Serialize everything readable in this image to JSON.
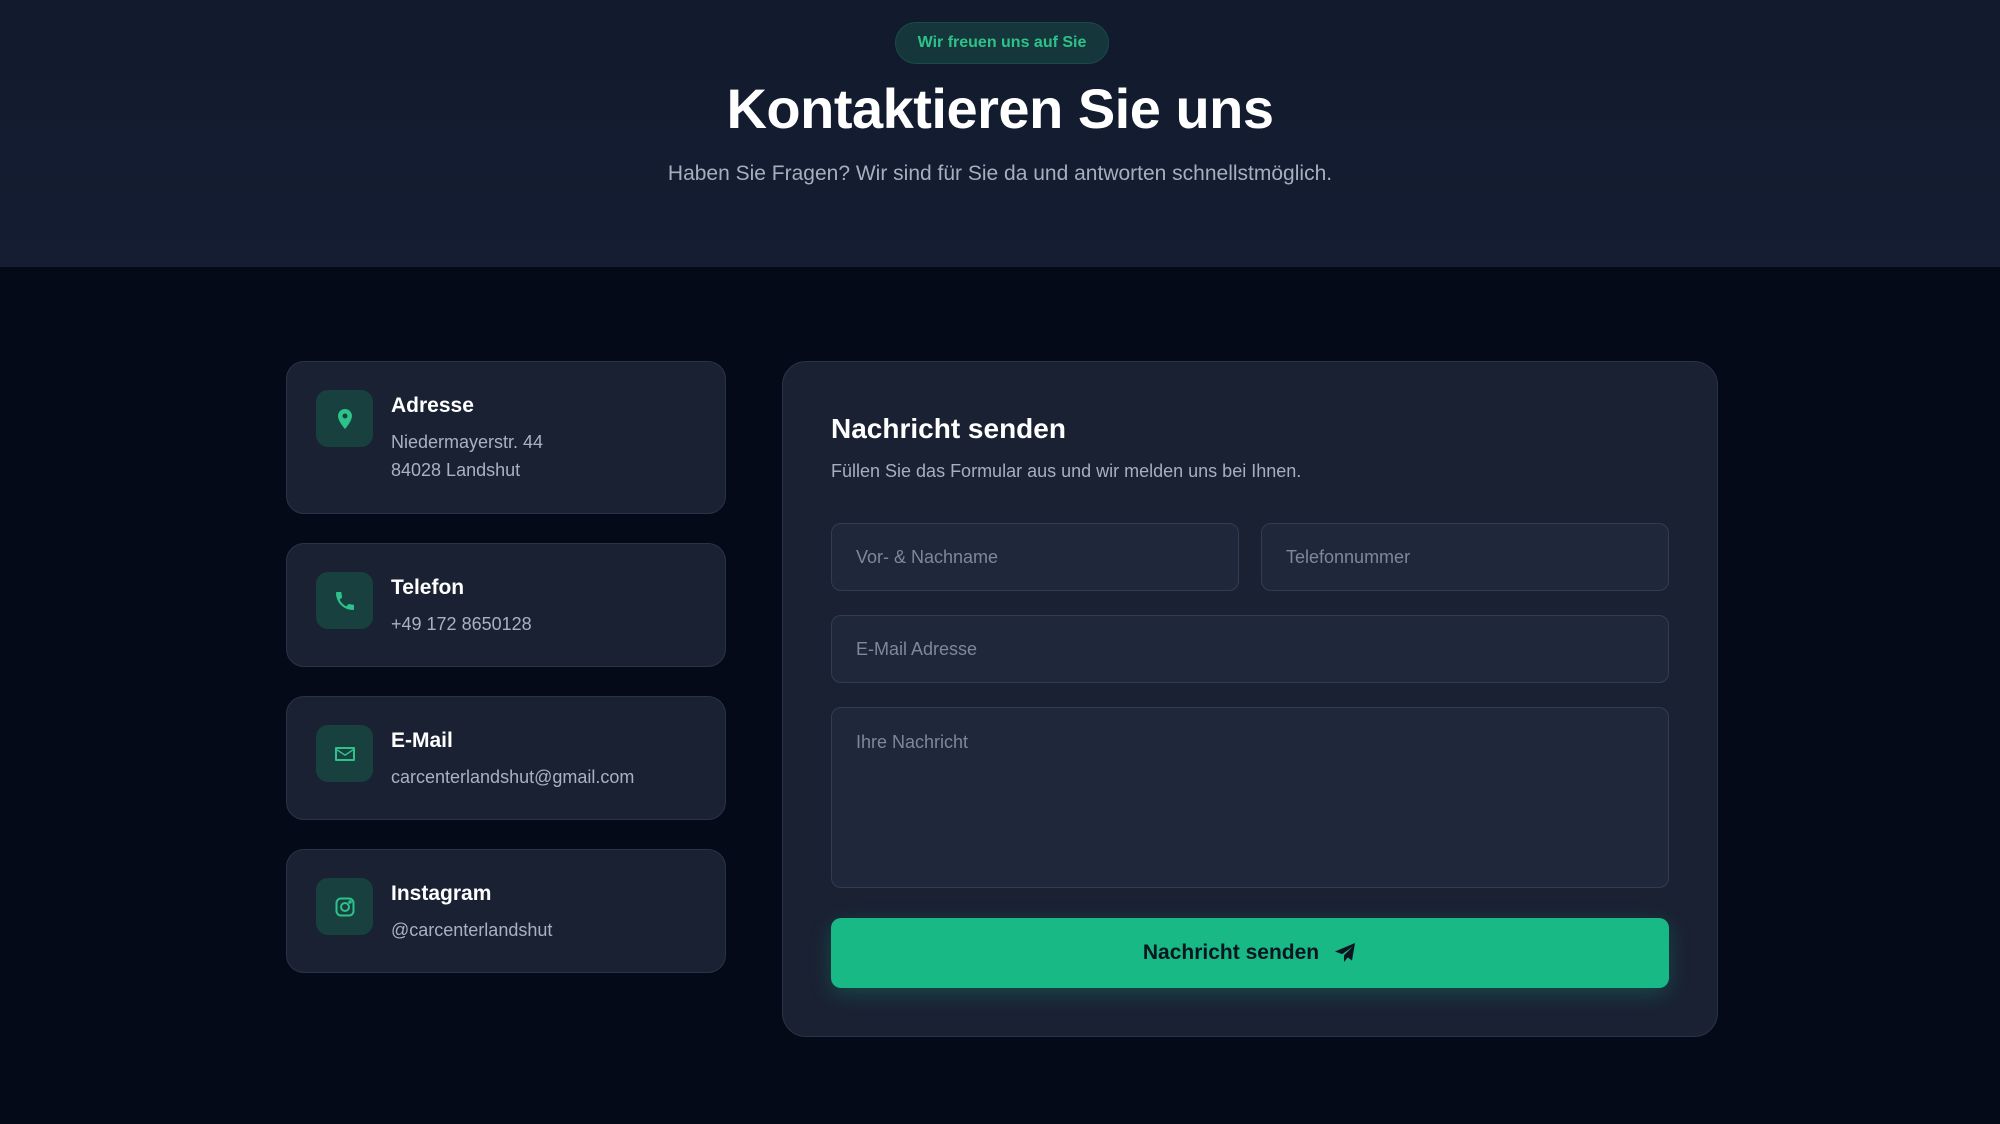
{
  "hero": {
    "badge": "Wir freuen uns auf Sie",
    "title": "Kontaktieren Sie uns",
    "subtitle": "Haben Sie Fragen? Wir sind für Sie da und antworten schnellstmöglich."
  },
  "contact_cards": [
    {
      "icon": "map-pin-icon",
      "title": "Adresse",
      "lines": [
        "Niedermayerstr. 44",
        "84028 Landshut"
      ]
    },
    {
      "icon": "phone-icon",
      "title": "Telefon",
      "lines": [
        "+49 172 8650128"
      ]
    },
    {
      "icon": "mail-icon",
      "title": "E-Mail",
      "lines": [
        "carcenterlandshut@gmail.com"
      ]
    },
    {
      "icon": "instagram-icon",
      "title": "Instagram",
      "lines": [
        "@carcenterlandshut"
      ]
    }
  ],
  "form": {
    "title": "Nachricht senden",
    "subtitle": "Füllen Sie das Formular aus und wir melden uns bei Ihnen.",
    "name_placeholder": "Vor- & Nachname",
    "phone_placeholder": "Telefonnummer",
    "email_placeholder": "E-Mail Adresse",
    "message_placeholder": "Ihre Nachricht",
    "submit_label": "Nachricht senden",
    "submit_icon": "send-icon"
  },
  "colors": {
    "accent": "#18b985",
    "accent_text": "#2ec28a",
    "icon_bg": "#18403f",
    "page_bg": "#050a19",
    "card_bg": "#1a2133"
  }
}
